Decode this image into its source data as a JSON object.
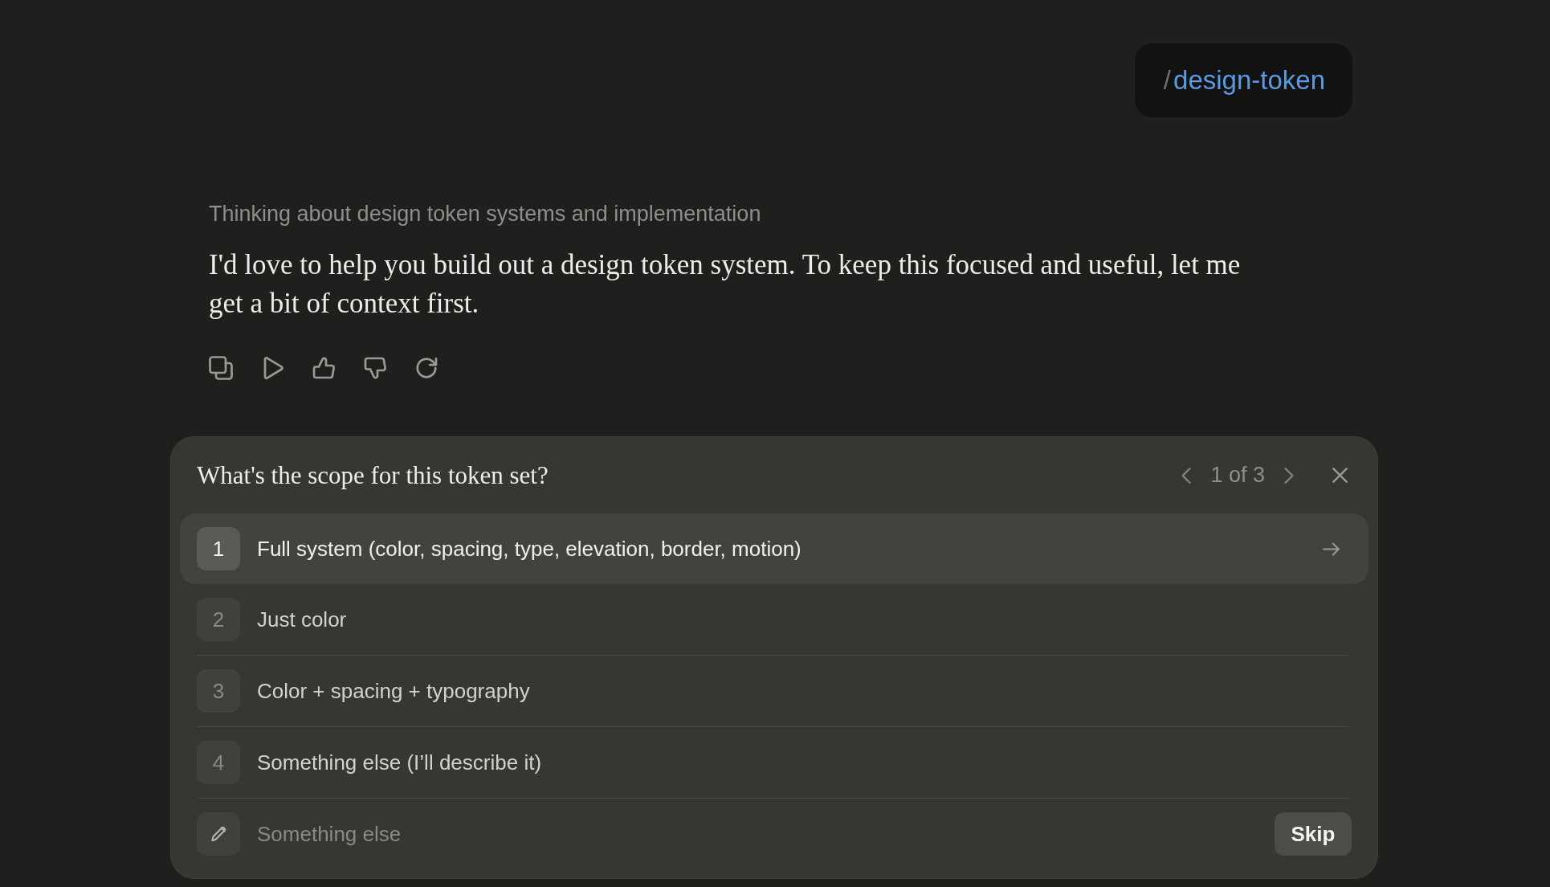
{
  "command": {
    "prefix": "/",
    "name": "design-token"
  },
  "thinking": "Thinking about design token systems and implementation",
  "message": "I'd love to help you build out a design token system. To keep this focused and useful, let me get a bit of context first.",
  "question": {
    "title": "What's the scope for this token set?",
    "pager": "1 of 3",
    "options": [
      {
        "number": "1",
        "label": "Full system (color, spacing, type, elevation, border, motion)",
        "selected": true
      },
      {
        "number": "2",
        "label": "Just color",
        "selected": false
      },
      {
        "number": "3",
        "label": "Color + spacing + typography",
        "selected": false
      },
      {
        "number": "4",
        "label": "Something else (I’ll describe it)",
        "selected": false
      }
    ],
    "input": {
      "placeholder": "Something else"
    },
    "skip_button": "Skip"
  }
}
